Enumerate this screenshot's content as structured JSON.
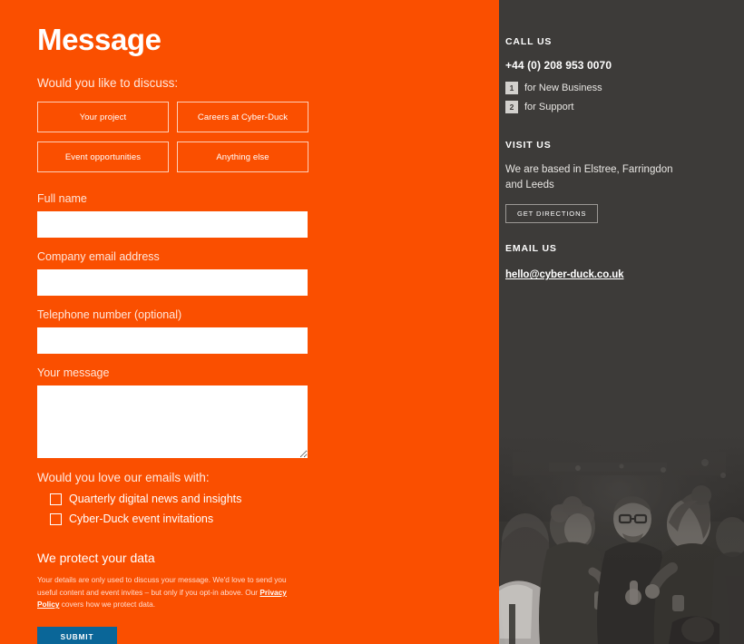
{
  "form": {
    "title": "Message",
    "discuss_label": "Would you like to discuss:",
    "topics": [
      {
        "label": "Your project"
      },
      {
        "label": "Careers at Cyber-Duck"
      },
      {
        "label": "Event opportunities"
      },
      {
        "label": "Anything else"
      }
    ],
    "fields": [
      {
        "label": "Full name",
        "value": "",
        "placeholder": ""
      },
      {
        "label": "Company email address",
        "value": "",
        "placeholder": ""
      },
      {
        "label": "Telephone number (optional)",
        "value": "",
        "placeholder": ""
      }
    ],
    "message_field": {
      "label": "Your message",
      "value": "",
      "placeholder": ""
    },
    "newsletter_label": "Would you love our emails with:",
    "checkboxes": [
      {
        "label": "Quarterly digital news and insights",
        "checked": false
      },
      {
        "label": "Cyber-Duck event invitations",
        "checked": false
      }
    ],
    "privacy": {
      "title": "We protect your data",
      "body_part1": "Your details are only used to discuss your message. We'd love to send you useful content and event invites – but only if you opt-in above. Our ",
      "link_text": "Privacy Policy",
      "body_part2": " covers how we protect data."
    },
    "submit_label": "SUBMIT"
  },
  "sidebar": {
    "call": {
      "heading": "CALL US",
      "phone": "+44 (0) 208 953 0070",
      "extensions": [
        {
          "key": "1",
          "text": "for New Business"
        },
        {
          "key": "2",
          "text": "for Support"
        }
      ]
    },
    "visit": {
      "heading": "VISIT US",
      "body": "We are based in Elstree, Farringdon and Leeds",
      "button_label": "GET DIRECTIONS"
    },
    "email": {
      "heading": "EMAIL US",
      "address": "hello@cyber-duck.co.uk"
    },
    "photo_alt": "People talking at a Cyber-Duck event"
  },
  "colors": {
    "brand_orange": "#fa4f00",
    "panel_dark": "#3d3b39",
    "submit_blue": "#0a6698",
    "text_white": "#ffffff",
    "muted_orange_text": "#ffe8de"
  }
}
